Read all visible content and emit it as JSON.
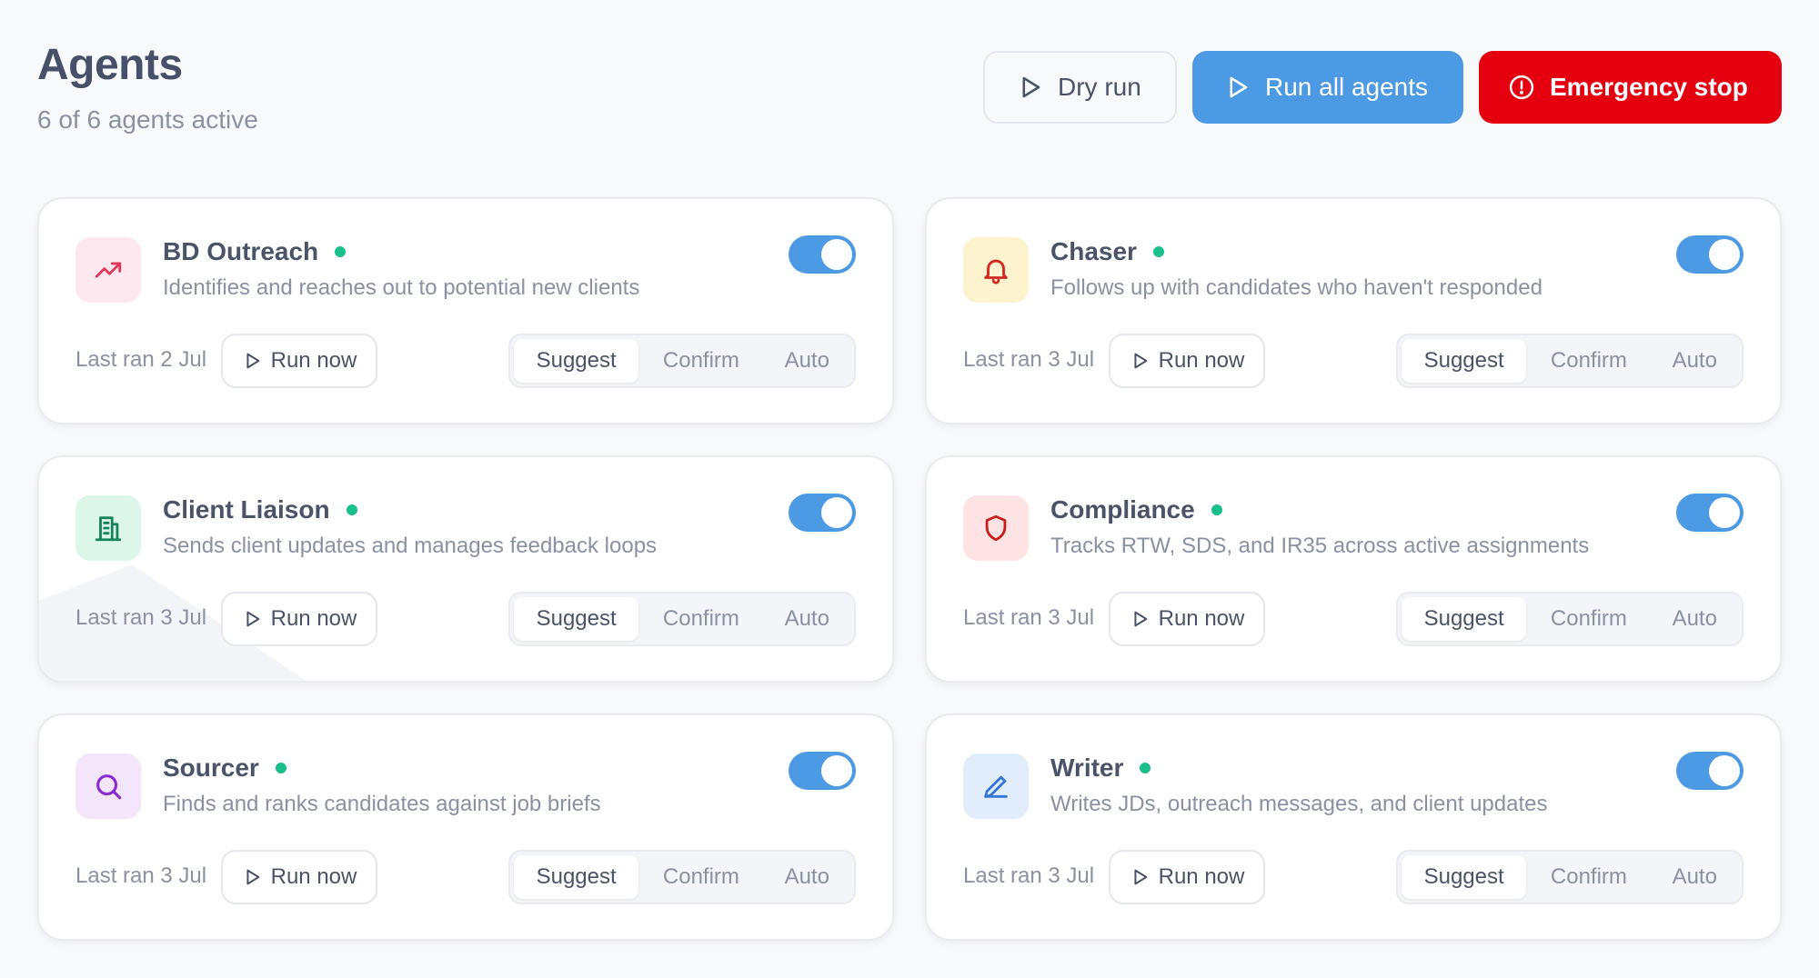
{
  "header": {
    "title": "Agents",
    "subtitle": "6 of 6 agents active",
    "dry_run_label": "Dry run",
    "run_all_label": "Run all agents",
    "emergency_stop_label": "Emergency stop"
  },
  "colors": {
    "accent": "#4c9ae3",
    "danger": "#e5000f",
    "active_dot": "#1bbf8b"
  },
  "mode_labels": [
    "Suggest",
    "Confirm",
    "Auto"
  ],
  "run_now_label": "Run now",
  "agents": [
    {
      "name": "BD Outreach",
      "description": "Identifies and reaches out to potential new clients",
      "last_ran": "Last ran 2 Jul",
      "icon": "trending-up-icon",
      "enabled": true,
      "mode": "Suggest",
      "tile_bg": "#fde8ef",
      "icon_color": "#e2375b"
    },
    {
      "name": "Chaser",
      "description": "Follows up with candidates who haven't responded",
      "last_ran": "Last ran 3 Jul",
      "icon": "bell-icon",
      "enabled": true,
      "mode": "Suggest",
      "tile_bg": "#fdf4cf",
      "icon_color": "#d1271f"
    },
    {
      "name": "Client Liaison",
      "description": "Sends client updates and manages feedback loops",
      "last_ran": "Last ran 3 Jul",
      "icon": "building-icon",
      "enabled": true,
      "mode": "Suggest",
      "tile_bg": "#dcf6ea",
      "icon_color": "#16835d"
    },
    {
      "name": "Compliance",
      "description": "Tracks RTW, SDS, and IR35 across active assignments",
      "last_ran": "Last ran 3 Jul",
      "icon": "shield-icon",
      "enabled": true,
      "mode": "Suggest",
      "tile_bg": "#fde3e3",
      "icon_color": "#c81d1d"
    },
    {
      "name": "Sourcer",
      "description": "Finds and ranks candidates against job briefs",
      "last_ran": "Last ran 3 Jul",
      "icon": "search-icon",
      "enabled": true,
      "mode": "Suggest",
      "tile_bg": "#f3e6fb",
      "icon_color": "#8a2bd1"
    },
    {
      "name": "Writer",
      "description": "Writes JDs, outreach messages, and client updates",
      "last_ran": "Last ran 3 Jul",
      "icon": "pen-icon",
      "enabled": true,
      "mode": "Suggest",
      "tile_bg": "#e2edfc",
      "icon_color": "#3477d6"
    }
  ]
}
